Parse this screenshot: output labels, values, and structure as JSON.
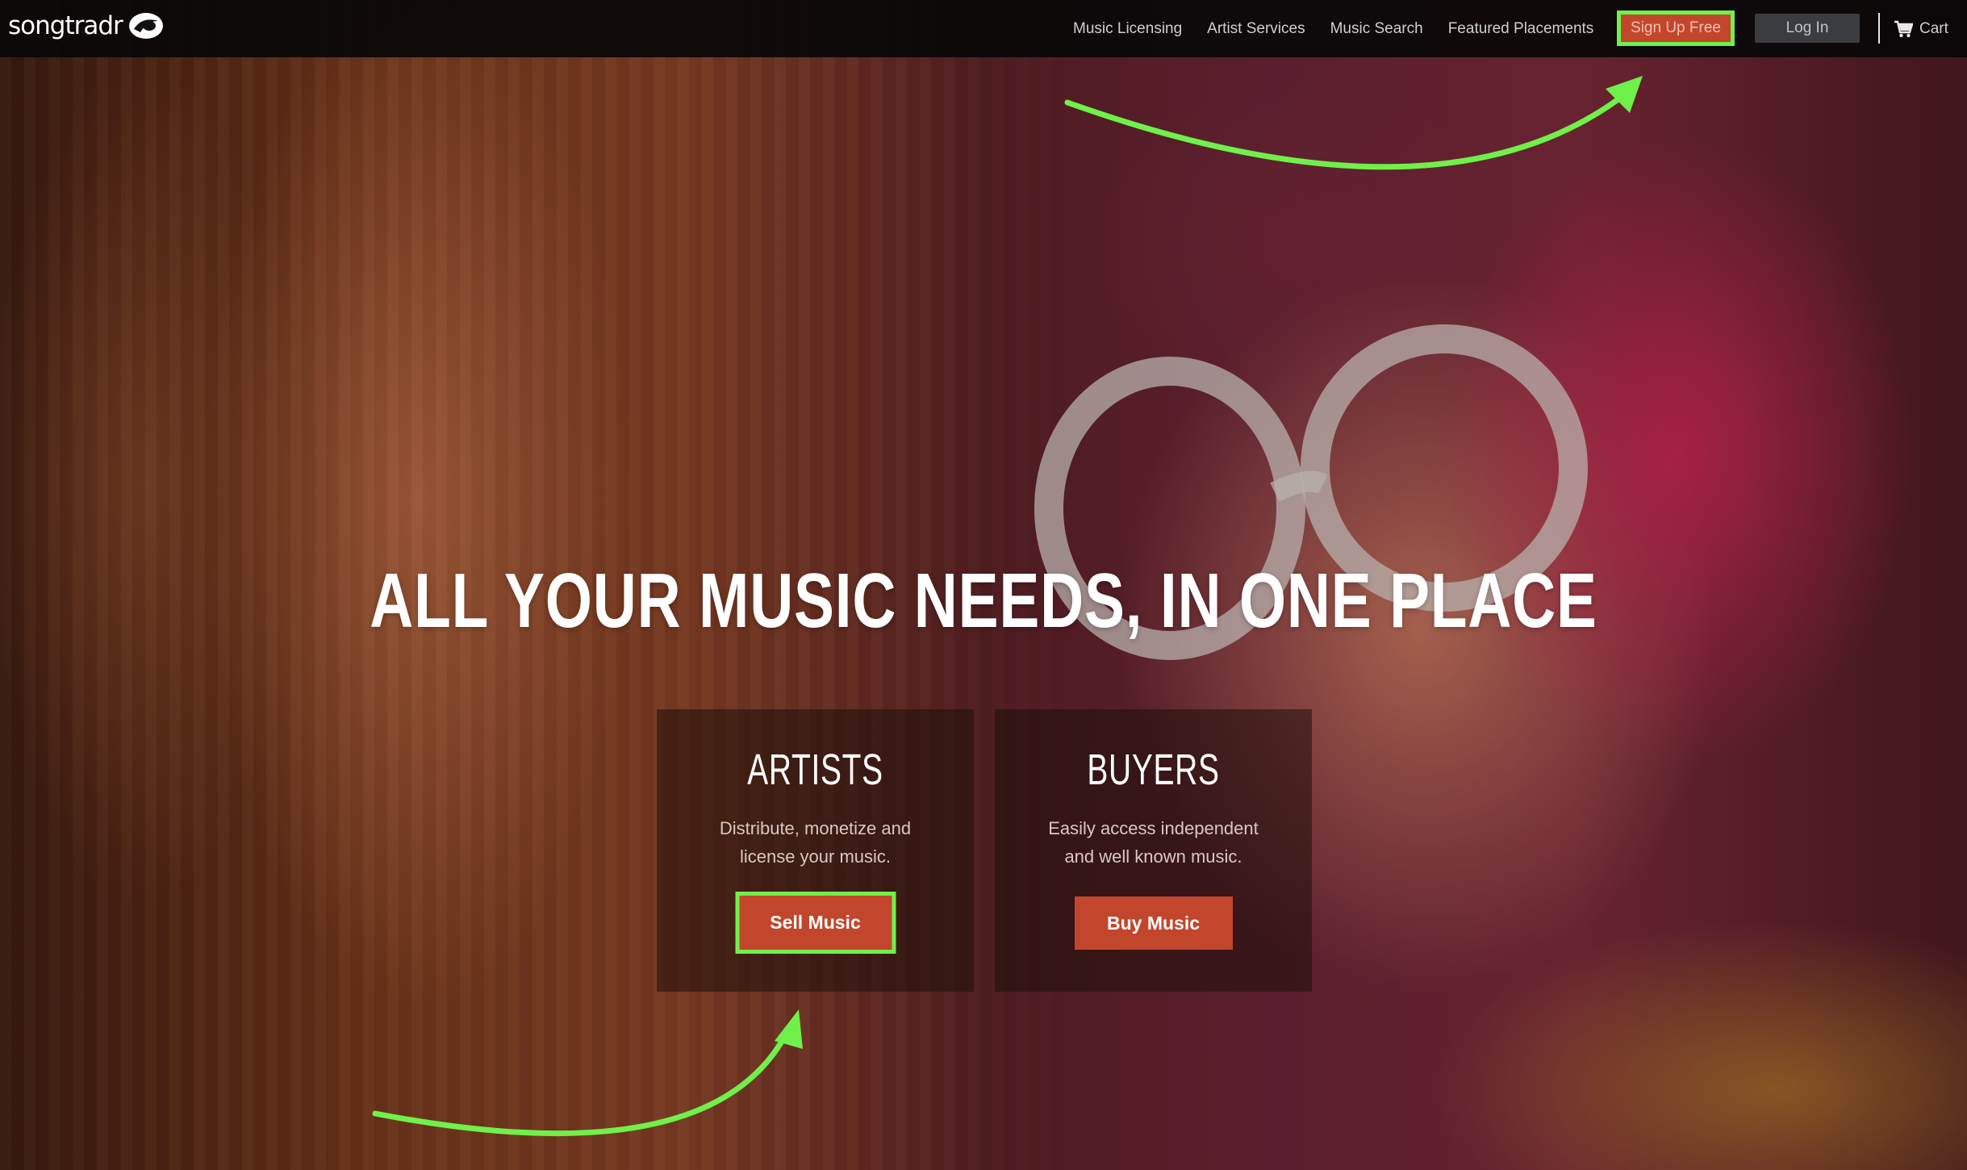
{
  "brand": {
    "name": "songtradr"
  },
  "nav": {
    "links": [
      {
        "label": "Music Licensing"
      },
      {
        "label": "Artist Services"
      },
      {
        "label": "Music Search"
      },
      {
        "label": "Featured Placements"
      }
    ],
    "signup_label": "Sign Up Free",
    "login_label": "Log In",
    "cart_label": "Cart",
    "cart_icon": "cart-icon"
  },
  "hero": {
    "title": "ALL YOUR MUSIC NEEDS, IN ONE PLACE",
    "cards": {
      "artists": {
        "title": "ARTISTS",
        "desc": "Distribute, monetize and license your music.",
        "button_label": "Sell Music"
      },
      "buyers": {
        "title": "BUYERS",
        "desc": "Easily access independent and well known music.",
        "button_label": "Buy Music"
      }
    }
  },
  "colors": {
    "accent": "#c2462c",
    "highlight": "#6ff04a",
    "navbar": "#080808"
  }
}
